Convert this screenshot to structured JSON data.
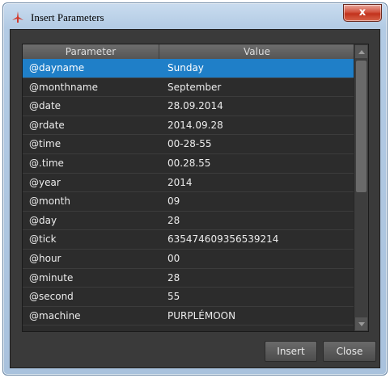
{
  "window": {
    "title": "Insert Parameters",
    "close_label": "x"
  },
  "grid": {
    "columns": {
      "parameter": "Parameter",
      "value": "Value"
    },
    "selected_index": 0,
    "rows": [
      {
        "param": "@dayname",
        "value": "Sunday"
      },
      {
        "param": "@monthname",
        "value": "September"
      },
      {
        "param": "@date",
        "value": "28.09.2014"
      },
      {
        "param": "@rdate",
        "value": "2014.09.28"
      },
      {
        "param": "@time",
        "value": "00-28-55"
      },
      {
        "param": "@.time",
        "value": "00.28.55"
      },
      {
        "param": "@year",
        "value": "2014"
      },
      {
        "param": "@month",
        "value": "09"
      },
      {
        "param": "@day",
        "value": "28"
      },
      {
        "param": "@tick",
        "value": "635474609356539214"
      },
      {
        "param": "@hour",
        "value": "00"
      },
      {
        "param": "@minute",
        "value": "28"
      },
      {
        "param": "@second",
        "value": "55"
      },
      {
        "param": "@machine",
        "value": "PURPLÉMOON"
      }
    ]
  },
  "buttons": {
    "insert": "Insert",
    "close": "Close"
  },
  "colors": {
    "selection": "#1f7fc8",
    "client_bg": "#3a3a3a",
    "titlebar": "#b3cbe4"
  },
  "icons": {
    "app": "app-logo-icon"
  }
}
